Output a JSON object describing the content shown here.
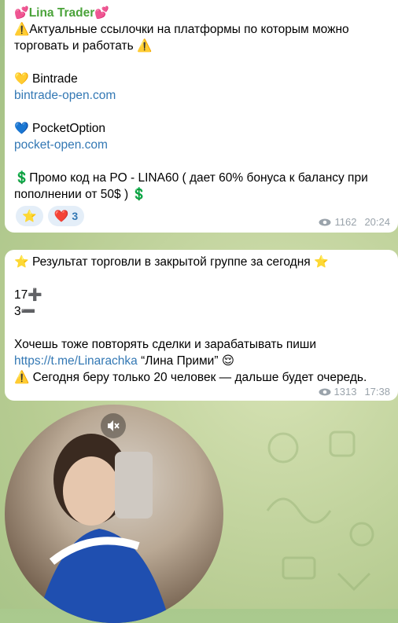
{
  "message1": {
    "author_emoji_left": "💕",
    "author": "Lina Trader",
    "author_emoji_right": "💕",
    "line1": "⚠️Актуальные ссылочки на платформы по которым можно",
    "line2": "торговать и работать ⚠️",
    "platform1_emoji": "💛",
    "platform1_name": "Bintrade",
    "platform1_link": "bintrade-open.com",
    "platform2_emoji": "💙",
    "platform2_name": "PocketOption",
    "platform2_link": "pocket-open.com",
    "promo_line1": "💲Промо код на PO - LINA60 ( дает 60% бонуса к балансу при",
    "promo_line2": "пополнении от 50$ ) 💲",
    "reactions": [
      {
        "emoji": "⭐",
        "count": ""
      },
      {
        "emoji": "❤️",
        "count": "3"
      }
    ],
    "views": "1162",
    "time": "20:24"
  },
  "message2": {
    "title": "Результат торговли в закрытой группе за сегодня",
    "title_emoji": "⭐",
    "stat1": "17",
    "stat1_emoji": "➕",
    "stat2": "3",
    "stat2_emoji": "➖",
    "cta": "Хочешь тоже повторять сделки и зарабатывать пиши",
    "link": "https://t.me/Linarachka",
    "link_suffix": "  “Лина Прими” 😌",
    "warning": "⚠️ Сегодня беру только 20 человек — дальше будет очередь.",
    "views": "1313",
    "time": "17:38"
  },
  "video_message": {
    "mute_icon": "muted-speaker-icon"
  },
  "colors": {
    "author": "#4aa33a",
    "link": "#3378b4",
    "meta": "#9aa3ab",
    "reaction_bg": "#e4eef8"
  }
}
